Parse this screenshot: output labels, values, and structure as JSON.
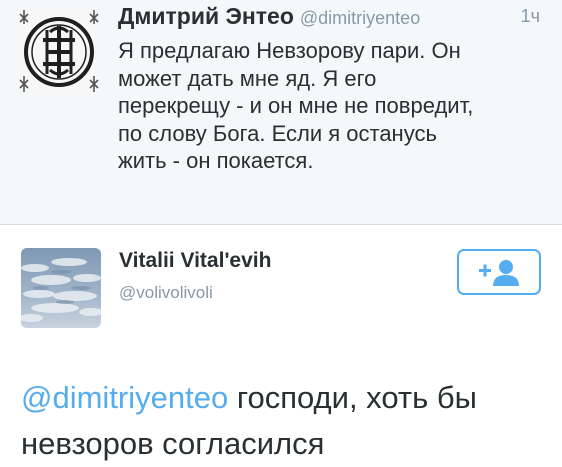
{
  "tweet_top": {
    "author_name": "Дмитрий Энтео",
    "author_handle": "@dimitriyenteo",
    "time_ago": "1ч",
    "text": "Я предлагаю Невзорову пари. Он\nможет дать мне яд. Я его\nперекрещу - и он мне не повредит,\nпо слову Бога. Если я останусь\nжить - он покается.",
    "avatar_icon": "orthodox-emblem-icon"
  },
  "tweet_detail": {
    "author_name": "Vitalii Vital'evih",
    "author_handle": "@volivolivoli",
    "avatar_icon": "sky-photo-avatar",
    "follow_icon": "add-user-icon",
    "mention": "@dimitriyenteo",
    "text_rest": " господи, хоть бы невзоров согласился"
  },
  "colors": {
    "accent": "#55acee",
    "text": "#292f33",
    "secondary": "#8899a6",
    "timeline_bg": "#f5f8fa"
  }
}
